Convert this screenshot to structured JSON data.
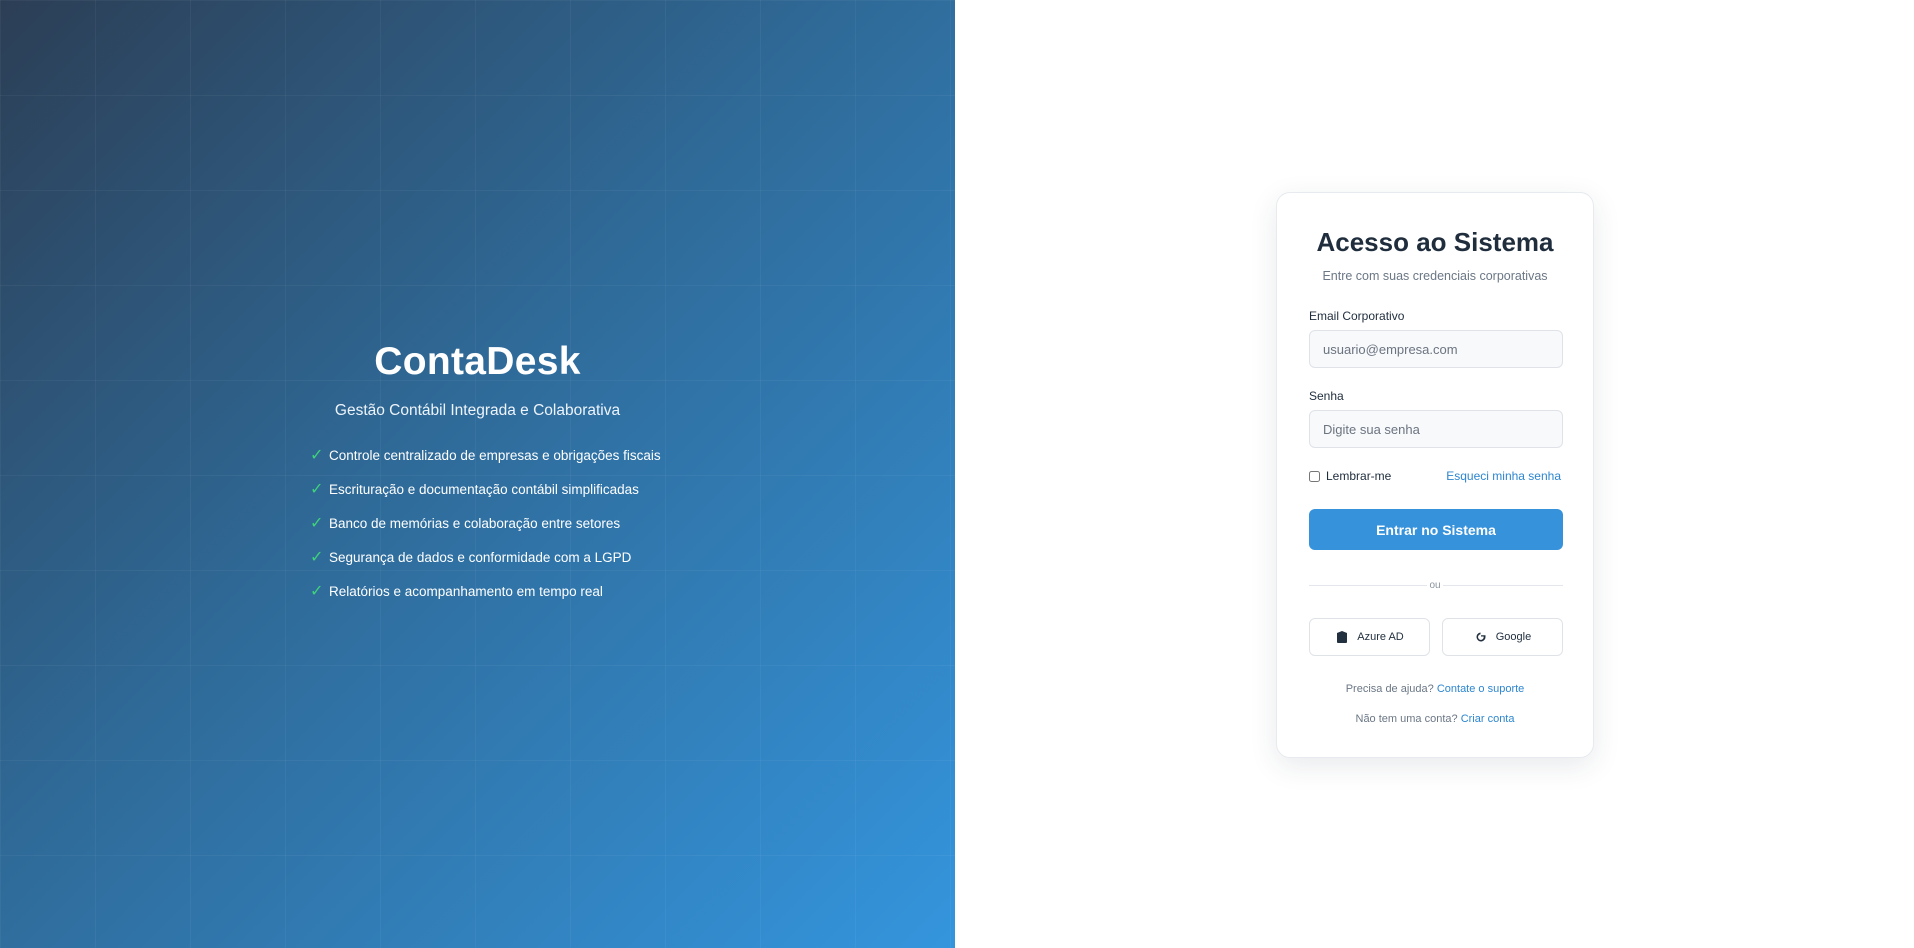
{
  "brand": {
    "title": "ContaDesk",
    "subtitle": "Gestão Contábil Integrada e Colaborativa",
    "features": [
      "Controle centralizado de empresas e obrigações fiscais",
      "Escrituração e documentação contábil simplificadas",
      "Banco de memórias e colaboração entre setores",
      "Segurança de dados e conformidade com a LGPD",
      "Relatórios e acompanhamento em tempo real"
    ],
    "check_icon": "check-icon",
    "check_color": "#3fd27a",
    "gradient_colors": [
      "#2c3e55",
      "#2f6a98",
      "#3495dd"
    ]
  },
  "login": {
    "title": "Acesso ao Sistema",
    "subtitle": "Entre com suas credenciais corporativas",
    "email_label": "Email Corporativo",
    "email_placeholder": "usuario@empresa.com",
    "email_value": "",
    "password_label": "Senha",
    "password_placeholder": "Digite sua senha",
    "password_value": "",
    "remember_label": "Lembrar-me",
    "remember_checked": false,
    "forgot_link": "Esqueci minha senha",
    "submit_label": "Entrar no Sistema",
    "divider_text": "ou",
    "sso": [
      {
        "label": "Azure AD",
        "icon": "azure-ad-icon"
      },
      {
        "label": "Google",
        "icon": "google-icon"
      }
    ],
    "help_text": "Precisa de ajuda?",
    "help_link": "Contate o suporte",
    "signup_text": "Não tem uma conta?",
    "signup_link": "Criar conta",
    "accent_color": "#3592db",
    "link_color": "#2d86cf"
  }
}
